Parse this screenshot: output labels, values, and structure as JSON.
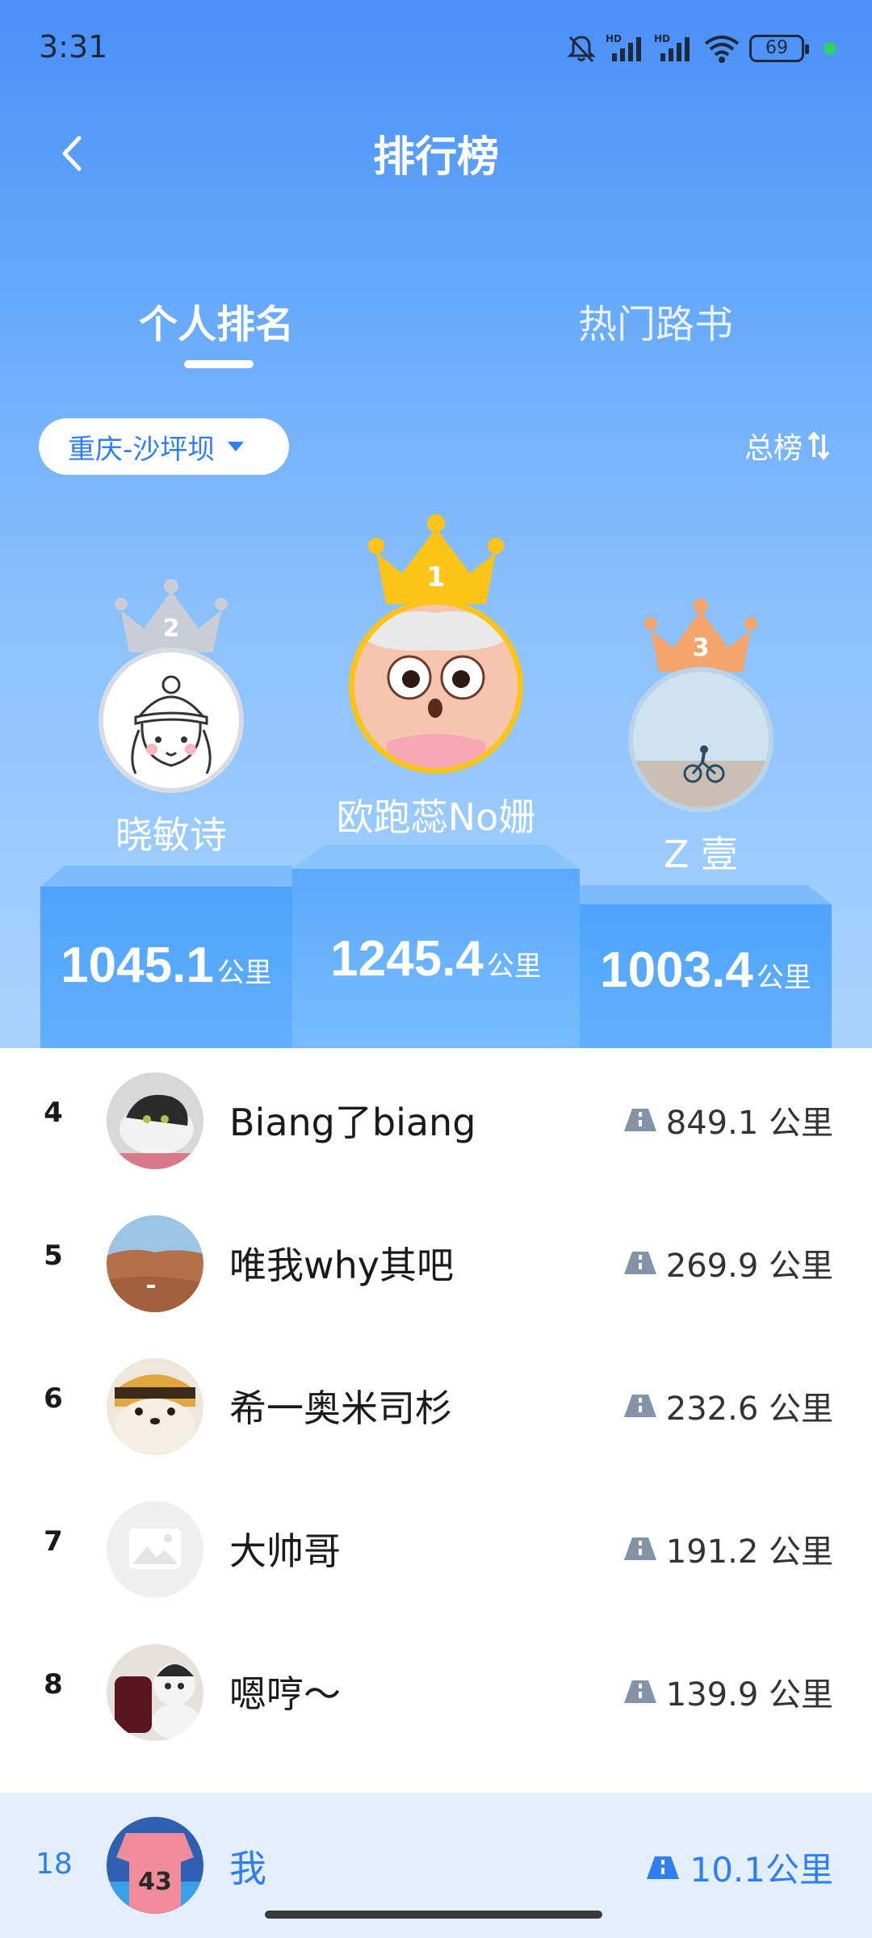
{
  "status_bar": {
    "time": "3:31",
    "battery": "69",
    "hd_1": "HD",
    "hd_2": "HD"
  },
  "header": {
    "title": "排行榜",
    "back_icon": "chevron-left-icon"
  },
  "tabs": [
    {
      "label": "个人排名",
      "active": true
    },
    {
      "label": "热门路书",
      "active": false
    }
  ],
  "filters": {
    "region": "重庆-沙坪坝",
    "ranking_type": "总榜"
  },
  "podium": [
    {
      "rank": "1",
      "name": "欧跑蕊No姗",
      "value": "1245.4",
      "unit": "公里",
      "crown_color": "#fbc417"
    },
    {
      "rank": "2",
      "name": "晓敏诗",
      "value": "1045.1",
      "unit": "公里",
      "crown_color": "#c9cdd6"
    },
    {
      "rank": "3",
      "name": "Z 壹",
      "value": "1003.4",
      "unit": "公里",
      "crown_color": "#f4a56c"
    }
  ],
  "list": [
    {
      "rank": "4",
      "name": "Biang了biang",
      "distance": "849.1 公里"
    },
    {
      "rank": "5",
      "name": "唯我why其吧",
      "distance": "269.9 公里"
    },
    {
      "rank": "6",
      "name": "希一奥米司杉",
      "distance": "232.6 公里"
    },
    {
      "rank": "7",
      "name": "大帅哥",
      "distance": "191.2 公里"
    },
    {
      "rank": "8",
      "name": "嗯哼～",
      "distance": "139.9 公里"
    }
  ],
  "me": {
    "rank": "18",
    "name": "我",
    "distance": "10.1公里"
  },
  "colors": {
    "accent": "#2f7ef3",
    "hero_top": "#4b8ff8",
    "hero_bottom": "#a9d3fe",
    "my_bar": "#e3effd"
  }
}
